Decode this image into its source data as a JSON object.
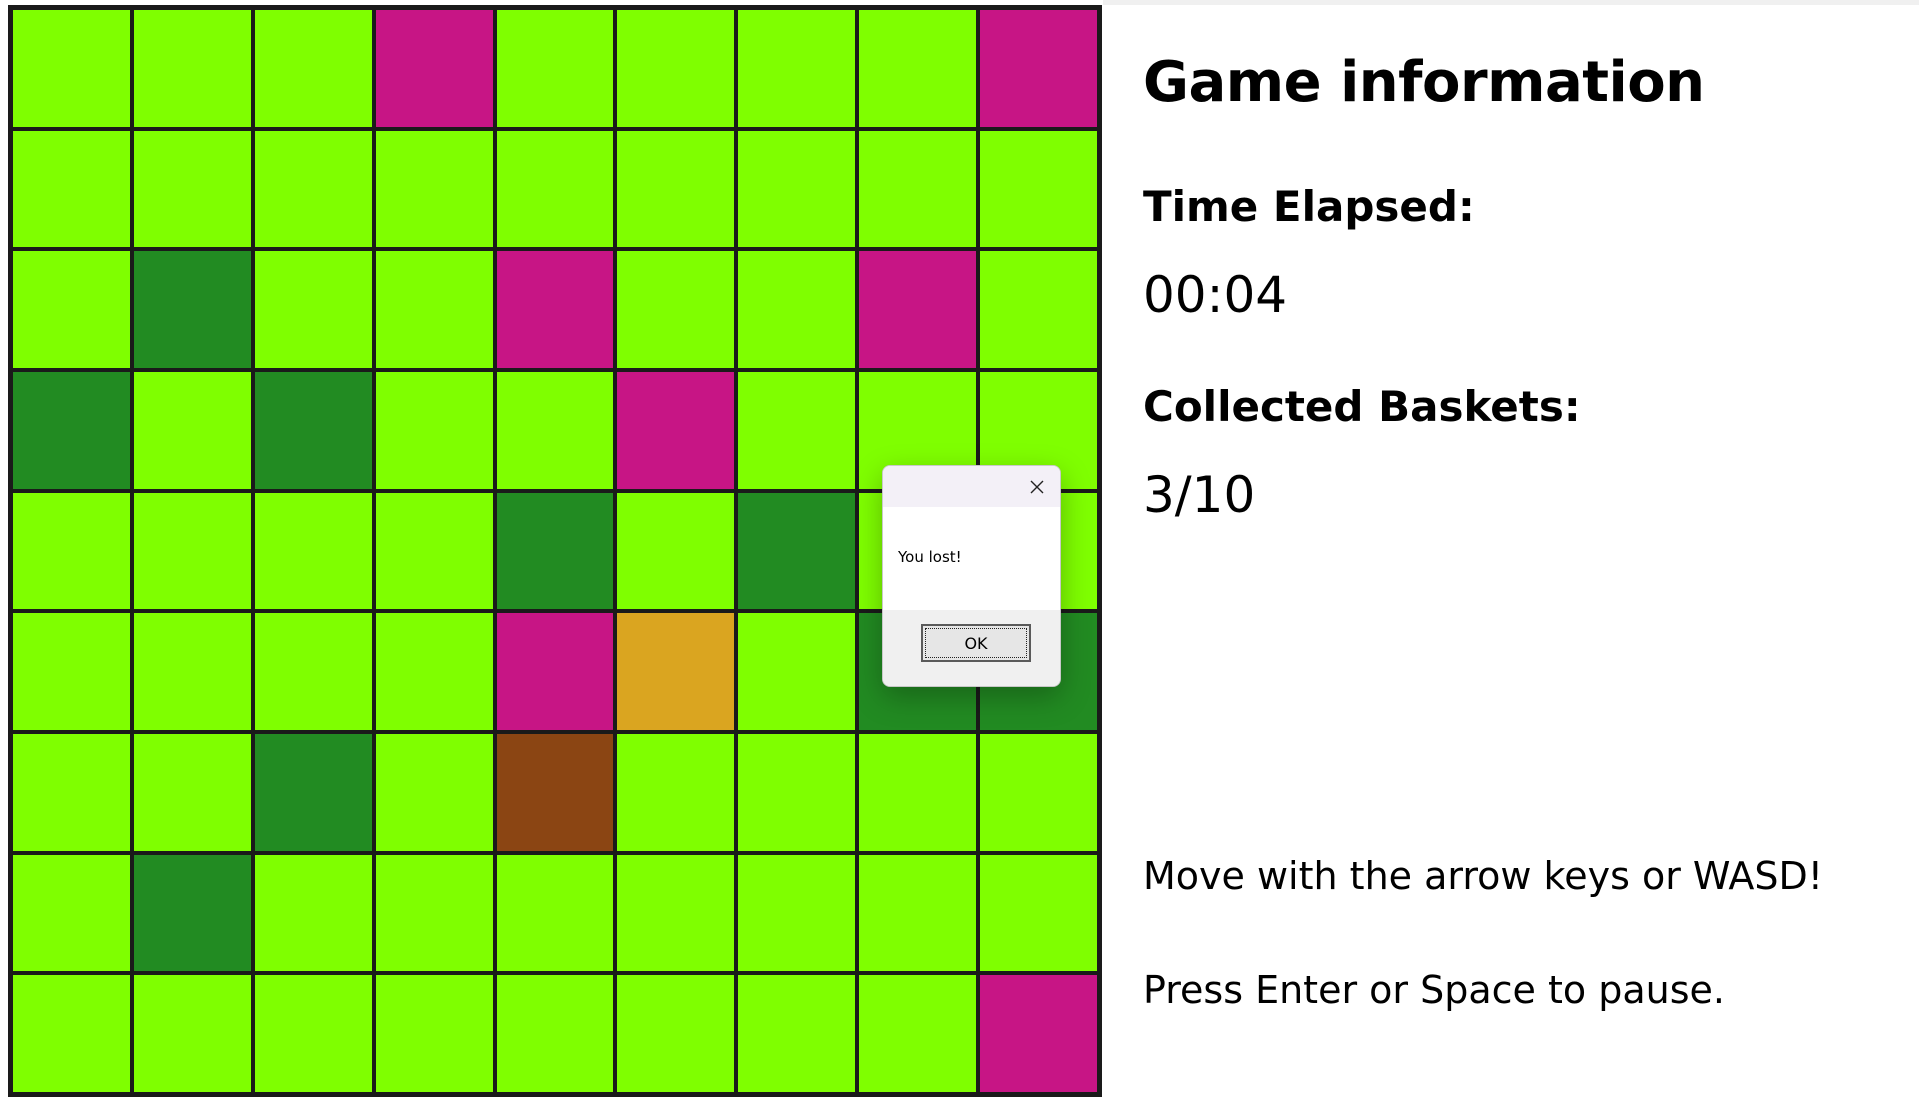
{
  "board": {
    "rows": [
      [
        "grass",
        "grass",
        "grass",
        "pink",
        "grass",
        "grass",
        "grass",
        "grass",
        "pink"
      ],
      [
        "grass",
        "grass",
        "grass",
        "grass",
        "grass",
        "grass",
        "grass",
        "grass",
        "grass"
      ],
      [
        "grass",
        "tree",
        "grass",
        "grass",
        "pink",
        "grass",
        "grass",
        "pink",
        "grass"
      ],
      [
        "tree",
        "grass",
        "tree",
        "grass",
        "grass",
        "pink",
        "grass",
        "grass",
        "grass"
      ],
      [
        "grass",
        "grass",
        "grass",
        "grass",
        "tree",
        "grass",
        "tree",
        "grass",
        "grass"
      ],
      [
        "grass",
        "grass",
        "grass",
        "grass",
        "pink",
        "player",
        "grass",
        "tree",
        "tree"
      ],
      [
        "grass",
        "grass",
        "tree",
        "grass",
        "dirt",
        "grass",
        "grass",
        "grass",
        "grass"
      ],
      [
        "grass",
        "tree",
        "grass",
        "grass",
        "grass",
        "grass",
        "grass",
        "grass",
        "grass"
      ],
      [
        "grass",
        "grass",
        "grass",
        "grass",
        "grass",
        "grass",
        "grass",
        "grass",
        "pink"
      ]
    ],
    "colors": {
      "grass": "#7fff00",
      "tree": "#228b22",
      "pink": "#c71585",
      "player": "#daa520",
      "dirt": "#8b4513"
    }
  },
  "info": {
    "title": "Game information",
    "time_label": "Time Elapsed:",
    "time_value": "00:04",
    "baskets_label": "Collected Baskets:",
    "baskets_value": "3/10",
    "hint_move": "Move with the arrow keys or WASD!",
    "hint_pause": "Press Enter or Space to pause."
  },
  "dialog": {
    "message": "You lost!",
    "ok_label": "OK",
    "close_icon": "close-icon"
  }
}
